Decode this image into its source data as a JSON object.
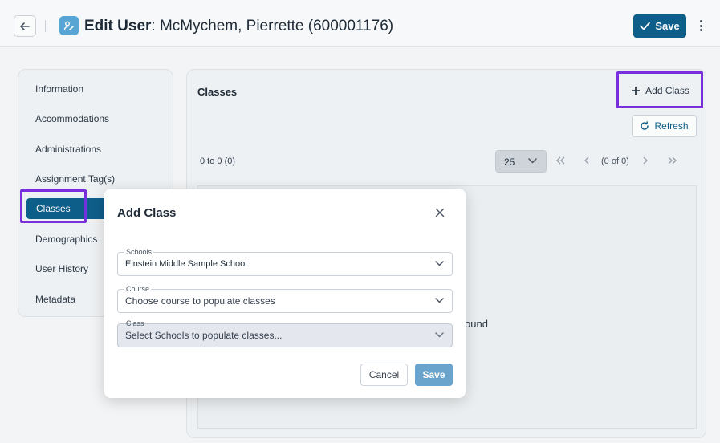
{
  "header": {
    "title_bold": "Edit User",
    "title_separator": ":",
    "title_rest": "McMychem, Pierrette (600001176)",
    "save_label": "Save"
  },
  "sidebar": {
    "items": [
      {
        "label": "Information"
      },
      {
        "label": "Accommodations"
      },
      {
        "label": "Administrations"
      },
      {
        "label": "Assignment Tag(s)"
      },
      {
        "label": "Classes",
        "active": true
      },
      {
        "label": "Demographics"
      },
      {
        "label": "User History"
      },
      {
        "label": "Metadata"
      }
    ]
  },
  "main": {
    "title": "Classes",
    "add_class_label": "Add Class",
    "refresh_label": "Refresh",
    "range_text": "0 to 0 (0)",
    "page_size": "25",
    "page_info": "(0 of 0)",
    "no_results_partial": "ound"
  },
  "modal": {
    "title": "Add Class",
    "fields": [
      {
        "label": "Schools",
        "value": "Einstein Middle Sample School",
        "disabled": false
      },
      {
        "label": "Course",
        "placeholder": "Choose course to populate classes",
        "disabled": false
      },
      {
        "label": "Class",
        "placeholder": "Select Schools to populate classes...",
        "disabled": true
      }
    ],
    "cancel_label": "Cancel",
    "save_label": "Save"
  },
  "colors": {
    "primary": "#0f5f8c",
    "highlight": "#7b2fe0",
    "save_disabled": "#6aa3cc"
  }
}
